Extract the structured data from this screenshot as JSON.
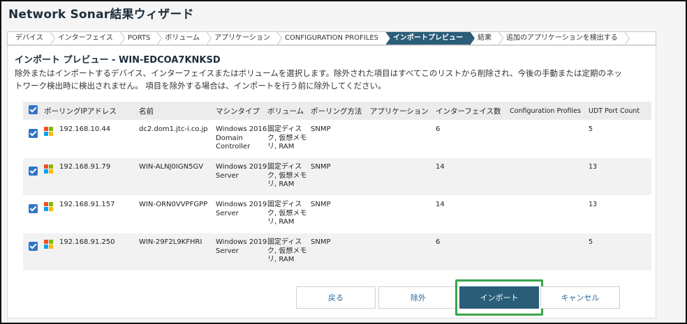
{
  "window": {
    "title": "Network Sonar結果ウィザード"
  },
  "steps": [
    {
      "label": "デバイス",
      "active": false
    },
    {
      "label": "インターフェイス",
      "active": false
    },
    {
      "label": "PORTS",
      "active": false
    },
    {
      "label": "ボリューム",
      "active": false
    },
    {
      "label": "アプリケーション",
      "active": false
    },
    {
      "label": "CONFIGURATION PROFILES",
      "active": false
    },
    {
      "label": "インポートプレビュー",
      "active": true
    },
    {
      "label": "結果",
      "active": false
    },
    {
      "label": "追加のアプリケーションを検出する",
      "active": false
    }
  ],
  "section": {
    "heading": "インポート プレビュー - WIN-EDCOA7KNKSD",
    "description": "除外またはインポートするデバイス、インターフェイスまたはボリュームを選択します。除外された項目はすべてこのリストから削除され、今後の手動または定期のネットワーク検出時に検出されません。 項目を除外する場合は、インポートを行う前に除外してください。"
  },
  "table": {
    "headers": {
      "ip": "ポーリングIPアドレス",
      "name": "名前",
      "machine": "マシンタイプ",
      "volume": "ボリューム",
      "poll": "ポーリング方法",
      "app": "アプリケーション",
      "ifc": "インターフェイス数",
      "cfg": "Configuration Profiles",
      "udt": "UDT Port Count"
    },
    "rows": [
      {
        "ip": "192.168.10.44",
        "name": "dc2.dom1.jtc-i.co.jp",
        "machine": "Windows 2016 Domain Controller",
        "volume": "固定ディスク, 仮想メモリ, RAM",
        "poll": "SNMP",
        "app": "",
        "ifc": "6",
        "cfg": "",
        "udt": "5",
        "checked": true
      },
      {
        "ip": "192.168.91.79",
        "name": "WIN-ALNJ0IGN5GV",
        "machine": "Windows 2019 Server",
        "volume": "固定ディスク, 仮想メモリ, RAM",
        "poll": "SNMP",
        "app": "",
        "ifc": "14",
        "cfg": "",
        "udt": "13",
        "checked": true
      },
      {
        "ip": "192.168.91.157",
        "name": "WIN-ORN0VVPFGPP",
        "machine": "Windows 2019 Server",
        "volume": "固定ディスク, 仮想メモリ, RAM",
        "poll": "SNMP",
        "app": "",
        "ifc": "14",
        "cfg": "",
        "udt": "13",
        "checked": true
      },
      {
        "ip": "192.168.91.250",
        "name": "WIN-29F2L9KFHRI",
        "machine": "Windows 2019 Server",
        "volume": "固定ディスク, 仮想メモリ, RAM",
        "poll": "SNMP",
        "app": "",
        "ifc": "6",
        "cfg": "",
        "udt": "5",
        "checked": true
      }
    ]
  },
  "buttons": {
    "back": "戻る",
    "exclude": "除外",
    "import": "インポート",
    "cancel": "キャンセル"
  },
  "colors": {
    "accent": "#2a5d78",
    "checkbox": "#2f76c7",
    "highlight": "#3aa54a"
  },
  "icons": {
    "os": "windows-logo-icon",
    "checkbox": "checkbox-checked-icon"
  }
}
